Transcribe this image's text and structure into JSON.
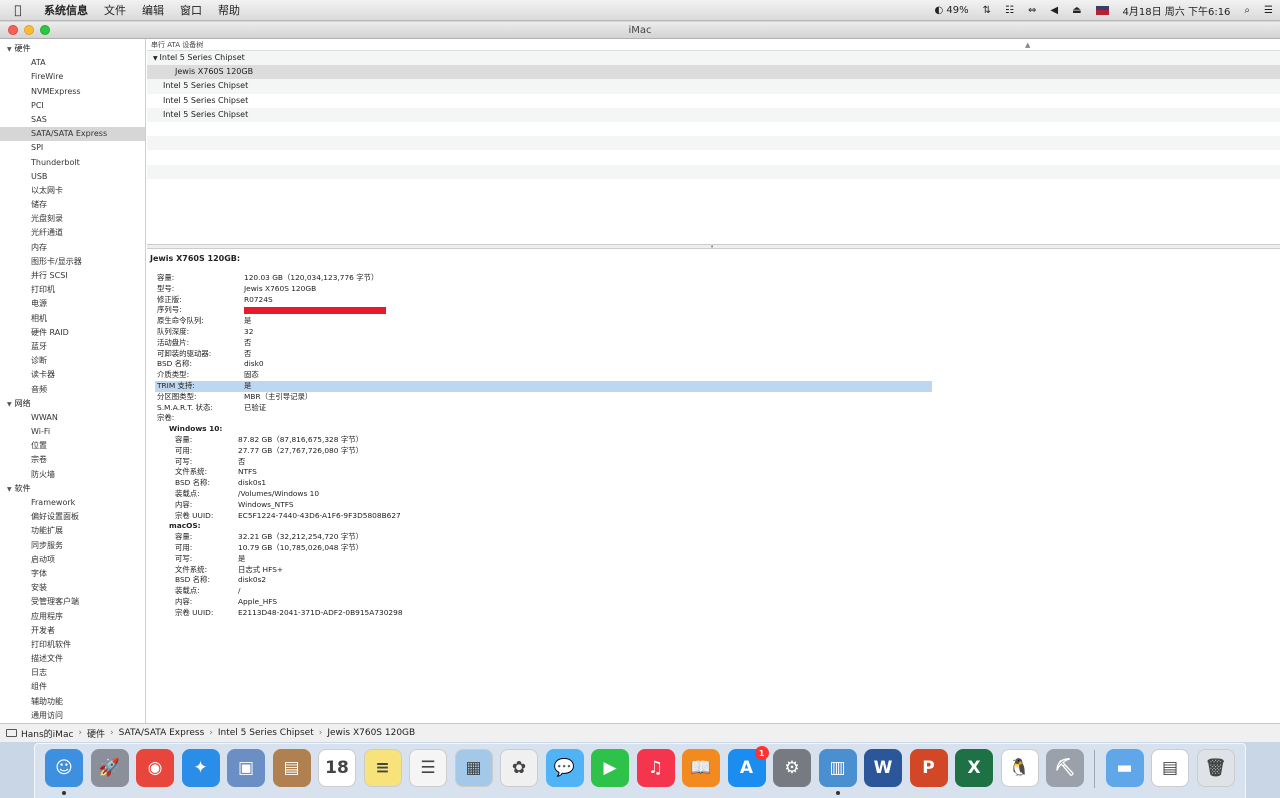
{
  "menubar": {
    "app_name": "系统信息",
    "menus": [
      "文件",
      "编辑",
      "窗口",
      "帮助"
    ],
    "battery": "49%",
    "datetime": "4月18日 周六 下午6:16"
  },
  "window": {
    "title": "iMac"
  },
  "sidebar": {
    "hardware_label": "硬件",
    "hardware_items": [
      "ATA",
      "FireWire",
      "NVMExpress",
      "PCI",
      "SAS",
      "SATA/SATA Express",
      "SPI",
      "Thunderbolt",
      "USB",
      "以太网卡",
      "储存",
      "光盘刻录",
      "光纤通道",
      "内存",
      "图形卡/显示器",
      "并行 SCSI",
      "打印机",
      "电源",
      "相机",
      "硬件 RAID",
      "蓝牙",
      "诊断",
      "读卡器",
      "音频"
    ],
    "network_label": "网络",
    "network_items": [
      "WWAN",
      "Wi-Fi",
      "位置",
      "宗卷",
      "防火墙"
    ],
    "software_label": "软件",
    "software_items": [
      "Framework",
      "偏好设置面板",
      "功能扩展",
      "同步服务",
      "启动项",
      "字体",
      "安装",
      "受管理客户端",
      "应用程序",
      "开发者",
      "打印机软件",
      "描述文件",
      "日志",
      "组件",
      "辅助功能",
      "通用访问"
    ]
  },
  "device_table": {
    "header": "串行 ATA 设备树",
    "rows": [
      {
        "label": "Intel 5 Series Chipset",
        "expanded": true
      },
      {
        "label": "Jewis X760S 120GB",
        "child": true,
        "selected": true
      },
      {
        "label": "Intel 5 Series Chipset"
      },
      {
        "label": "Intel 5 Series Chipset"
      },
      {
        "label": "Intel 5 Series Chipset"
      }
    ]
  },
  "detail": {
    "title": "Jewis X760S 120GB:",
    "properties": [
      {
        "k": "容量:",
        "v": "120.03 GB（120,034,123,776 字节）"
      },
      {
        "k": "型号:",
        "v": "Jewis X760S 120GB"
      },
      {
        "k": "修正版:",
        "v": "R0724S"
      },
      {
        "k": "序列号:",
        "v": ""
      },
      {
        "k": "原生命令队列:",
        "v": "是"
      },
      {
        "k": "队列深度:",
        "v": "32"
      },
      {
        "k": "活动盘片:",
        "v": "否"
      },
      {
        "k": "可卸装的驱动器:",
        "v": "否"
      },
      {
        "k": "BSD 名称:",
        "v": "disk0"
      },
      {
        "k": "介质类型:",
        "v": "固态"
      },
      {
        "k": "TRIM 支持:",
        "v": "是"
      },
      {
        "k": "分区图类型:",
        "v": "MBR（主引导记录）"
      },
      {
        "k": "S.M.A.R.T. 状态:",
        "v": "已验证"
      },
      {
        "k": "宗卷:",
        "v": ""
      }
    ],
    "volumes": [
      {
        "name": "Windows 10:",
        "props": [
          {
            "k": "容量:",
            "v": "87.82 GB（87,816,675,328 字节）"
          },
          {
            "k": "可用:",
            "v": "27.77 GB（27,767,726,080 字节）"
          },
          {
            "k": "可写:",
            "v": "否"
          },
          {
            "k": "文件系统:",
            "v": "NTFS"
          },
          {
            "k": "BSD 名称:",
            "v": "disk0s1"
          },
          {
            "k": "装载点:",
            "v": "/Volumes/Windows 10"
          },
          {
            "k": "内容:",
            "v": "Windows_NTFS"
          },
          {
            "k": "宗卷 UUID:",
            "v": "EC5F1224-7440-43D6-A1F6-9F3D5808B627"
          }
        ]
      },
      {
        "name": "macOS:",
        "props": [
          {
            "k": "容量:",
            "v": "32.21 GB（32,212,254,720 字节）"
          },
          {
            "k": "可用:",
            "v": "10.79 GB（10,785,026,048 字节）"
          },
          {
            "k": "可写:",
            "v": "是"
          },
          {
            "k": "文件系统:",
            "v": "日志式 HFS+"
          },
          {
            "k": "BSD 名称:",
            "v": "disk0s2"
          },
          {
            "k": "装载点:",
            "v": "/"
          },
          {
            "k": "内容:",
            "v": "Apple_HFS"
          },
          {
            "k": "宗卷 UUID:",
            "v": "E2113D48-2041-371D-ADF2-0B915A730298"
          }
        ]
      }
    ]
  },
  "pathbar": [
    "Hans的iMac",
    "硬件",
    "SATA/SATA Express",
    "Intel 5 Series Chipset",
    "Jewis X760S 120GB"
  ],
  "dock": {
    "items": [
      {
        "name": "finder-icon",
        "glyph": "☺",
        "color": "#3d8fe0"
      },
      {
        "name": "launchpad-icon",
        "glyph": "🚀",
        "color": "#8a8f99"
      },
      {
        "name": "chrome-icon",
        "glyph": "◉",
        "color": "#e8453c"
      },
      {
        "name": "safari-icon",
        "glyph": "✦",
        "color": "#2a8de8"
      },
      {
        "name": "preview-icon",
        "glyph": "▣",
        "color": "#6b8fc4"
      },
      {
        "name": "notes-book-icon",
        "glyph": "▤",
        "color": "#b08050"
      },
      {
        "name": "calendar-icon",
        "glyph": "18",
        "color": "#ffffff"
      },
      {
        "name": "notes-icon",
        "glyph": "≡",
        "color": "#f7e37a"
      },
      {
        "name": "reminders-icon",
        "glyph": "☰",
        "color": "#f5f5f5"
      },
      {
        "name": "stickies-icon",
        "glyph": "▦",
        "color": "#a4c8e8"
      },
      {
        "name": "photos-icon",
        "glyph": "✿",
        "color": "#f0f0f0"
      },
      {
        "name": "messages-icon",
        "glyph": "💬",
        "color": "#4fb3f6"
      },
      {
        "name": "facetime-icon",
        "glyph": "▶",
        "color": "#2ec24a"
      },
      {
        "name": "music-icon",
        "glyph": "♫",
        "color": "#f5344e"
      },
      {
        "name": "books-icon",
        "glyph": "📖",
        "color": "#f38a1f"
      },
      {
        "name": "app-store-icon",
        "glyph": "A",
        "color": "#1b8cf0",
        "badge": "1"
      },
      {
        "name": "system-preferences-icon",
        "glyph": "⚙",
        "color": "#777a80"
      },
      {
        "name": "system-info-icon",
        "glyph": "▥",
        "color": "#4a8fd0"
      },
      {
        "name": "word-icon",
        "glyph": "W",
        "color": "#2b579a"
      },
      {
        "name": "powerpoint-icon",
        "glyph": "P",
        "color": "#d24726"
      },
      {
        "name": "excel-icon",
        "glyph": "X",
        "color": "#1e7145"
      },
      {
        "name": "qq-icon",
        "glyph": "🐧",
        "color": "#ffffff"
      },
      {
        "name": "disk-utility-icon",
        "glyph": "⛏",
        "color": "#9aa1aa"
      },
      {
        "name": "folder-icon",
        "glyph": "▬",
        "color": "#5fa7e8"
      },
      {
        "name": "documents-icon",
        "glyph": "▤",
        "color": "#ffffff"
      },
      {
        "name": "trash-icon",
        "glyph": "🗑",
        "color": "#dfe3e8"
      }
    ]
  }
}
